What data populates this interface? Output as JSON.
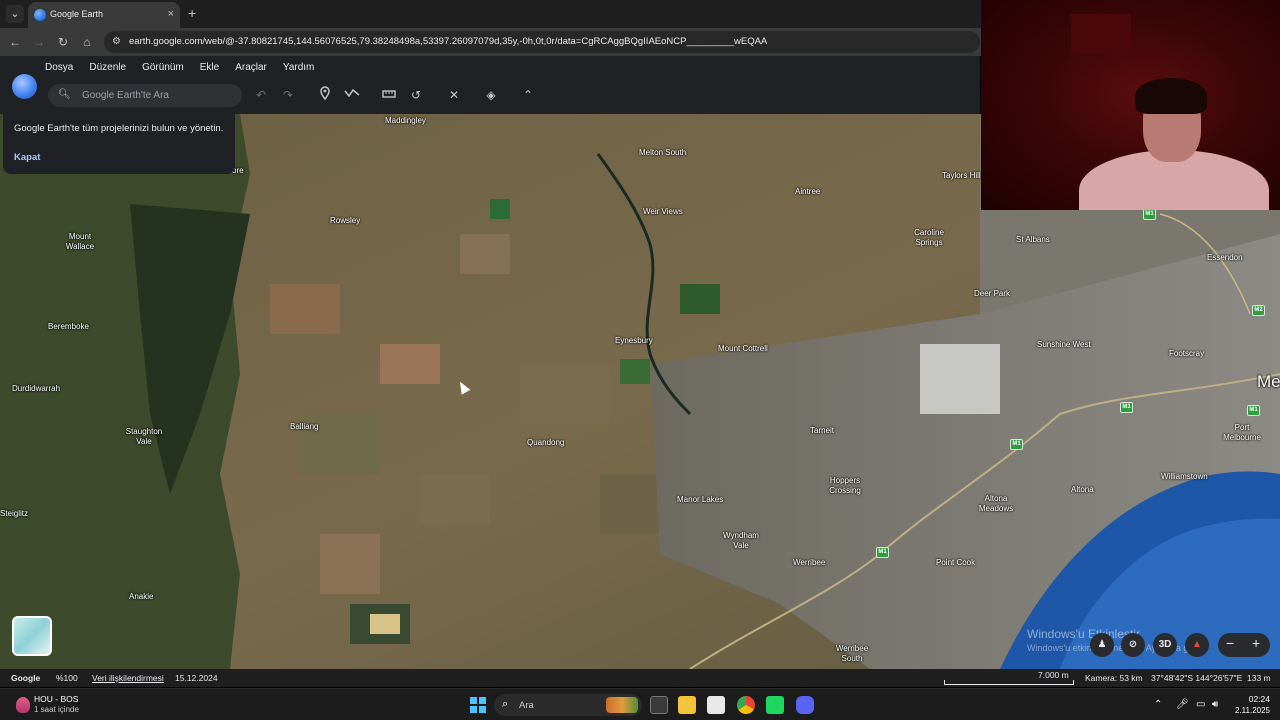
{
  "browser": {
    "tab_title": "Google Earth",
    "tab_close": "×",
    "new_tab": "+",
    "url": "earth.google.com/web/@-37.80821745,144.56076525,79.38248498a,53397.26097079d,35y,-0h,0t,0r/data=CgRCAggBQgIIAEoNCP_________wEQAA"
  },
  "ge": {
    "menu": [
      "Dosya",
      "Düzenle",
      "Görünüm",
      "Ekle",
      "Araçlar",
      "Yardım"
    ],
    "search_placeholder": "Google Earth'te Ara",
    "popup_text": "Google Earth'te tüm projelerinizi bulun ve yönetin.",
    "popup_close": "Kapat",
    "ctrl_3d": "3D"
  },
  "places": [
    "Maddingley",
    "Melton South",
    "Aintree",
    "Taylors Hill",
    "Weir Views",
    "Caroline Springs",
    "St Albans",
    "Essendon",
    "Deer Park",
    "Rowsley",
    "Mount Wallace",
    "Beremboke",
    "Eynesbury",
    "Mount Cottrell",
    "Sunshine West",
    "Footscray",
    "Durdidwarrah",
    "Staughton Vale",
    "Balliang",
    "Quandong",
    "Tarneit",
    "Port Melbourne",
    "Hoppers Crossing",
    "Altona Meadows",
    "Altona",
    "Williamstown",
    "Manor Lakes",
    "Wyndham Vale",
    "Werribee",
    "Point Cook",
    "Anakie",
    "Werribee South",
    "Steiglitz",
    "ore",
    "Me"
  ],
  "shields": [
    "M1",
    "M1",
    "M1",
    "M1",
    "M2",
    "M1"
  ],
  "watermark": {
    "line1": "Windows'u Etkinleştir",
    "line2": "Windows'u etkinleştirmek için Ayarlar'a gidin."
  },
  "status": {
    "brand": "Google",
    "zoom": "%100",
    "data_attribution": "Veri ilişkilendirmesi",
    "date": "15.12.2024",
    "scale": "7.000 m",
    "camera": "Kamera: 53 km",
    "coords": "37°48'42\"S 144°26'57\"E",
    "elevation": "133 m"
  },
  "taskbar": {
    "weather_title": "HOU - BOS",
    "weather_sub": "1 saat içinde",
    "search_placeholder": "Ara",
    "time": "02:24",
    "date": "2.11.2025"
  },
  "colors": {
    "browser_bg": "#1f1f1f",
    "ge_header": "#202124",
    "link_blue": "#a8c7fa",
    "shield_green": "#2e9e3e",
    "water": "#1f57a8"
  }
}
